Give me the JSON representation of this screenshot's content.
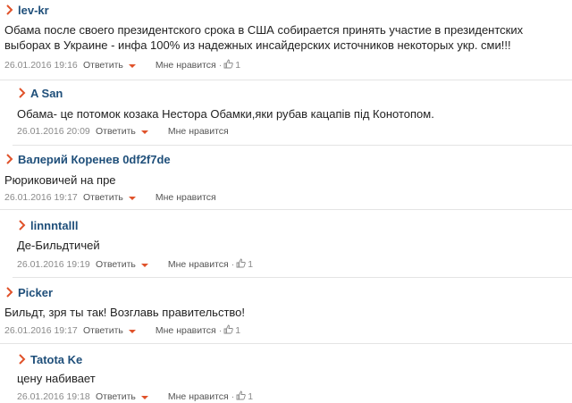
{
  "comments": [
    {
      "author": "lev-kr",
      "text": "Обама после своего президентского срока в США собирается принять участие в президентских выборах в Украине - инфа 100% из надежных инсайдерских источников некоторых укр. сми!!!",
      "date": "26.01.2016 19:16",
      "reply_label": "Ответить",
      "like_label": "Мне нравится",
      "like_count": "1",
      "like_sep": "·"
    },
    {
      "author": "A San",
      "text": "Обама- це потомок козака Нестора Обамки,яки рубав кацапів під Конотопом.",
      "date": "26.01.2016 20:09",
      "reply_label": "Ответить",
      "like_label": "Мне нравится"
    },
    {
      "author": "Валерий Коренев 0df2f7de",
      "text": "Рюриковичей на пре",
      "date": "26.01.2016 19:17",
      "reply_label": "Ответить",
      "like_label": "Мне нравится"
    },
    {
      "author": "linnntalll",
      "text": "Де-Бильдтичей",
      "date": "26.01.2016 19:19",
      "reply_label": "Ответить",
      "like_label": "Мне нравится",
      "like_count": "1",
      "like_sep": "·"
    },
    {
      "author": "Picker",
      "text": "Бильдт, зря ты так! Возглавь правительство!",
      "date": "26.01.2016 19:17",
      "reply_label": "Ответить",
      "like_label": "Мне нравится",
      "like_count": "1",
      "like_sep": "·"
    },
    {
      "author": "Tatota Ke",
      "text": "цену набивает",
      "date": "26.01.2016 19:18",
      "reply_label": "Ответить",
      "like_label": "Мне нравится",
      "like_count": "1",
      "like_sep": "·"
    }
  ],
  "colors": {
    "author": "#1f4f7a",
    "chevron": "#e0522a",
    "caret": "#e0522a",
    "meta": "#8a8a8a",
    "divider": "#e4e4e4"
  },
  "icons": {
    "author_marker": "chevron-right-icon",
    "reply_dropdown": "caret-down-icon",
    "like": "thumbs-up-icon"
  }
}
